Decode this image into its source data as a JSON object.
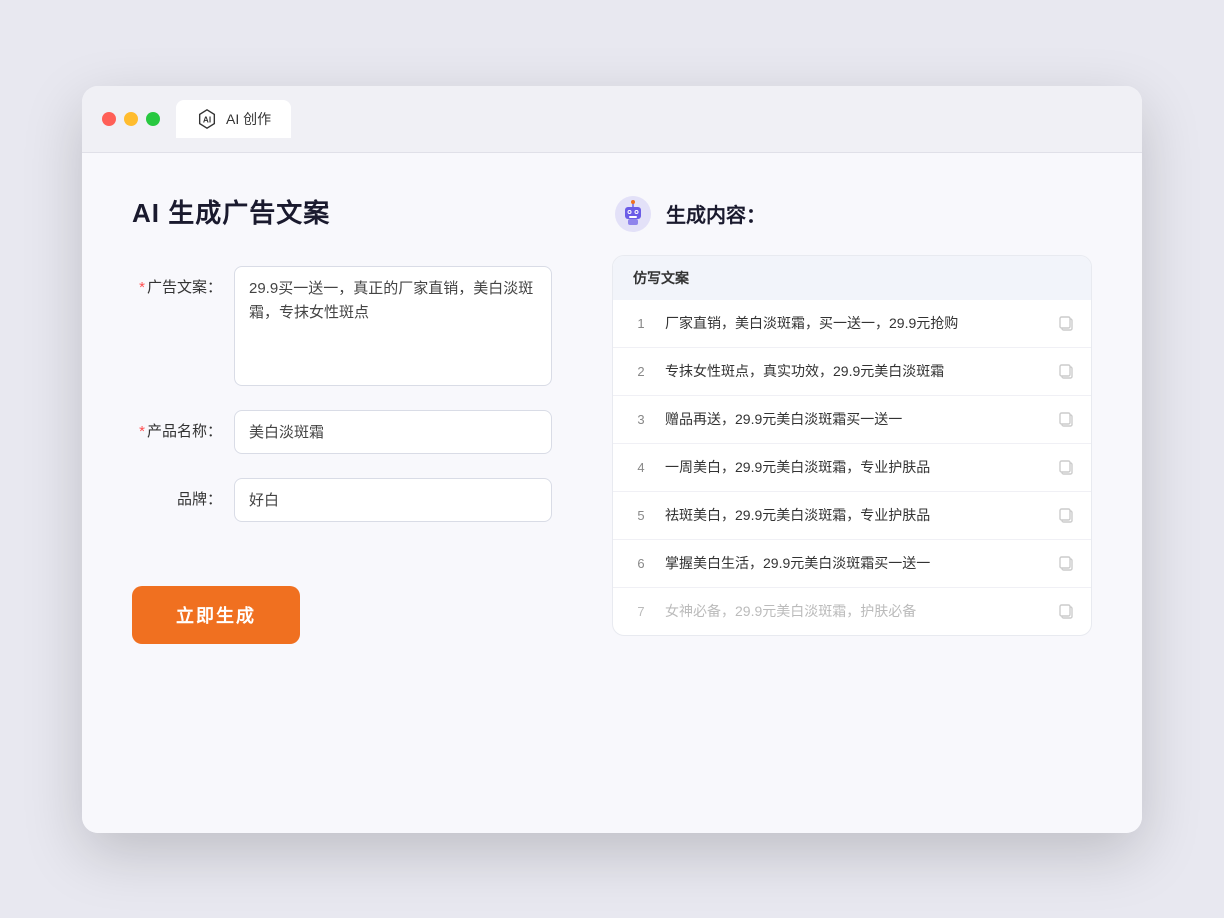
{
  "browser": {
    "tab_label": "AI 创作"
  },
  "page": {
    "title": "AI 生成广告文案",
    "result_header": "生成内容："
  },
  "form": {
    "ad_copy_label": "广告文案：",
    "ad_copy_required": "*",
    "ad_copy_value": "29.9买一送一，真正的厂家直销，美白淡斑霜，专抹女性斑点",
    "product_name_label": "产品名称：",
    "product_name_required": "*",
    "product_name_value": "美白淡斑霜",
    "brand_label": "品牌：",
    "brand_value": "好白",
    "generate_button": "立即生成"
  },
  "results": {
    "table_header": "仿写文案",
    "items": [
      {
        "num": "1",
        "text": "厂家直销，美白淡斑霜，买一送一，29.9元抢购"
      },
      {
        "num": "2",
        "text": "专抹女性斑点，真实功效，29.9元美白淡斑霜"
      },
      {
        "num": "3",
        "text": "赠品再送，29.9元美白淡斑霜买一送一"
      },
      {
        "num": "4",
        "text": "一周美白，29.9元美白淡斑霜，专业护肤品"
      },
      {
        "num": "5",
        "text": "祛斑美白，29.9元美白淡斑霜，专业护肤品"
      },
      {
        "num": "6",
        "text": "掌握美白生活，29.9元美白淡斑霜买一送一"
      },
      {
        "num": "7",
        "text": "女神必备，29.9元美白淡斑霜，护肤必备",
        "faded": true
      }
    ]
  },
  "colors": {
    "orange": "#f07020",
    "red_dot": "#ff5f57",
    "yellow_dot": "#ffbc2e",
    "green_dot": "#28c840"
  }
}
